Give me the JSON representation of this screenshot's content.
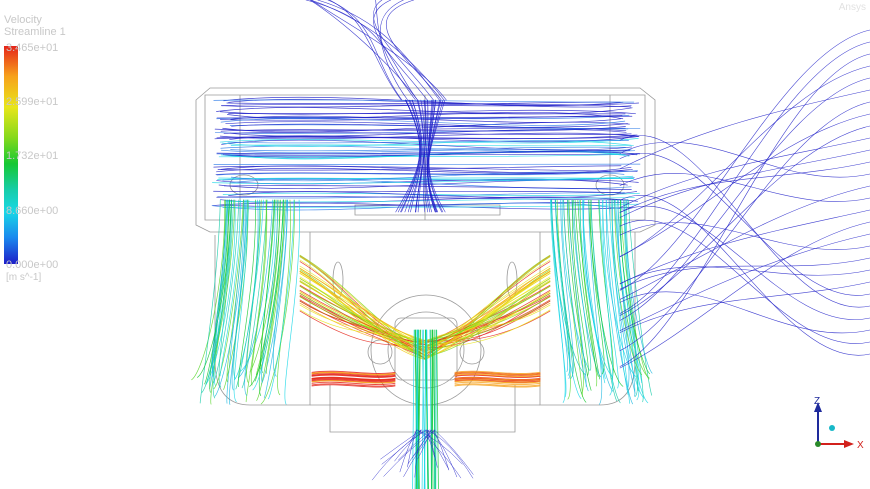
{
  "legend": {
    "title": "Velocity",
    "subtitle": "Streamline 1",
    "ticks": [
      "3.465e+01",
      "2.599e+01",
      "1.732e+01",
      "8.660e+00",
      "0.000e+00"
    ],
    "unit": "[m s^-1]"
  },
  "corner_mark": "Ansys",
  "triad": {
    "z_label": "Z",
    "x_label": "X"
  },
  "colors": {
    "background": "#ffffff",
    "geometry_outline": "#9a9a9a",
    "low": "#1e1ec8",
    "mid_low": "#19d7e6",
    "mid": "#16c833",
    "mid_high": "#e8e61a",
    "high": "#e5241a",
    "axis_z": "#1e2a9c",
    "axis_x": "#d2201b",
    "axis_y_dot": "#18b8c8"
  }
}
